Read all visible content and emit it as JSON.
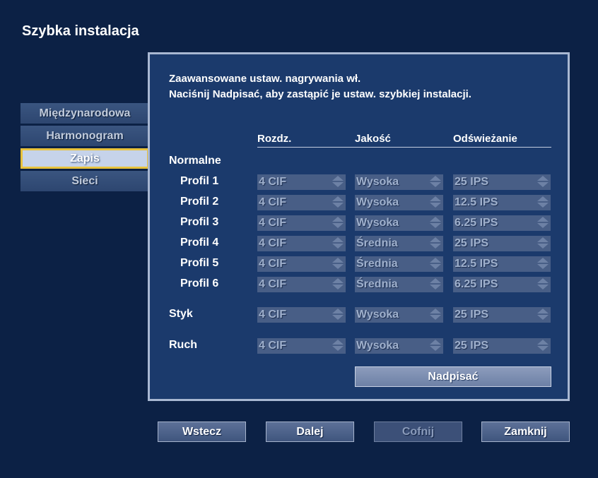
{
  "title": "Szybka instalacja",
  "sidebar": {
    "items": [
      "Międzynarodowa",
      "Harmonogram",
      "Zapis",
      "Sieci"
    ],
    "active": "Zapis"
  },
  "info": {
    "line1": "Zaawansowane ustaw. nagrywania wł.",
    "line2": "Naciśnij Nadpisać, aby zastąpić je ustaw. szybkiej instalacji."
  },
  "columns": {
    "resolution": "Rozdz.",
    "quality": "Jakość",
    "refresh": "Odświeżanie"
  },
  "group_normal": "Normalne",
  "rows": [
    {
      "label": "Profil 1",
      "res": "4 CIF",
      "quality": "Wysoka",
      "rate": "25 IPS"
    },
    {
      "label": "Profil 2",
      "res": "4 CIF",
      "quality": "Wysoka",
      "rate": "12.5 IPS"
    },
    {
      "label": "Profil 3",
      "res": "4 CIF",
      "quality": "Wysoka",
      "rate": "6.25 IPS"
    },
    {
      "label": "Profil 4",
      "res": "4 CIF",
      "quality": "Średnia",
      "rate": "25 IPS"
    },
    {
      "label": "Profil 5",
      "res": "4 CIF",
      "quality": "Średnia",
      "rate": "12.5 IPS"
    },
    {
      "label": "Profil 6",
      "res": "4 CIF",
      "quality": "Średnia",
      "rate": "6.25 IPS"
    },
    {
      "label": "Styk",
      "res": "4 CIF",
      "quality": "Wysoka",
      "rate": "25 IPS"
    },
    {
      "label": "Ruch",
      "res": "4 CIF",
      "quality": "Wysoka",
      "rate": "25 IPS"
    }
  ],
  "overwrite_label": "Nadpisać",
  "buttons": {
    "back": "Wstecz",
    "next": "Dalej",
    "undo": "Cofnij",
    "close": "Zamknij"
  }
}
